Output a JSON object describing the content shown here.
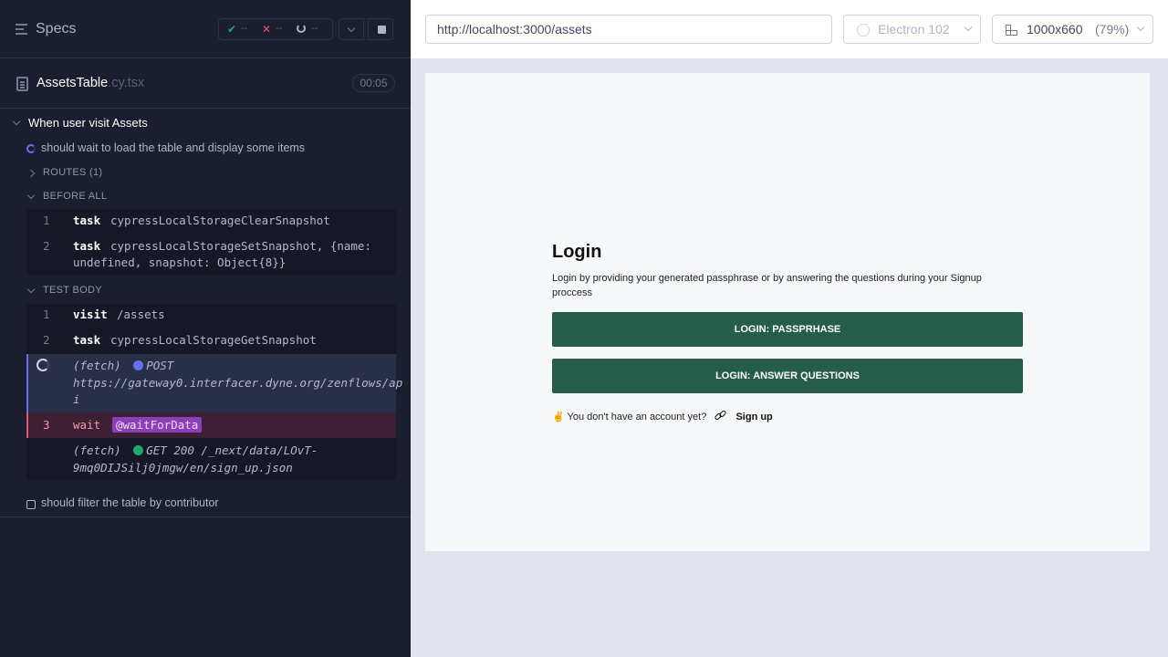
{
  "reporter": {
    "specs_label": "Specs",
    "stats": {
      "passed": "--",
      "failed": "--",
      "pending": "--"
    },
    "file": {
      "name": "AssetsTable",
      "ext": ".cy.tsx",
      "duration": "00:05"
    },
    "suite_title": "When user visit Assets",
    "running_test": "should wait to load the table and display some items",
    "routes_label": "ROUTES (1)",
    "before_all_label": "BEFORE ALL",
    "before_all_cmds": [
      {
        "num": "1",
        "name": "task",
        "msg": "cypressLocalStorageClearSnapshot"
      },
      {
        "num": "2",
        "name": "task",
        "msg_line1": "cypressLocalStorageSetSnapshot, {name:",
        "msg_line2": "undefined, snapshot: Object{8}}"
      }
    ],
    "test_body_label": "TEST BODY",
    "test_body_cmds": [
      {
        "num": "1",
        "name": "visit",
        "msg": "/assets"
      },
      {
        "num": "2",
        "name": "task",
        "msg": "cypressLocalStorageGetSnapshot"
      }
    ],
    "fetch_pending": {
      "type": "(fetch)",
      "method": "POST",
      "url_line1": "https://gateway0.interfacer.dyne.org/zenflows/ap",
      "url_line2": "i"
    },
    "wait_cmd": {
      "num": "3",
      "name": "wait",
      "alias": "@waitForData"
    },
    "fetch_done": {
      "type": "(fetch)",
      "method": "GET 200 /_next/data/LOvT-",
      "line2": "9mq0DIJSilj0jmgw/en/sign_up.json"
    },
    "next_test": "should filter the table by contributor",
    "colors": {
      "pending_dot": "#6470f3",
      "success_dot": "#1fa971",
      "alias_bg": "#8b3fb8"
    }
  },
  "browser": {
    "url": "http://localhost:3000/assets",
    "browser_name": "Electron 102",
    "viewport": "1000x660",
    "scale": "(79%)"
  },
  "app": {
    "title": "Login",
    "description": "Login by providing your generated passphrase or by answering the questions during your Signup proccess",
    "btn_passphrase": "LOGIN: PASSPRHASE",
    "btn_questions": "LOGIN: ANSWER QUESTIONS",
    "no_account": "✌️ You don't have an account yet?",
    "signup_link": "Sign up",
    "brand_color": "#265c4a"
  }
}
